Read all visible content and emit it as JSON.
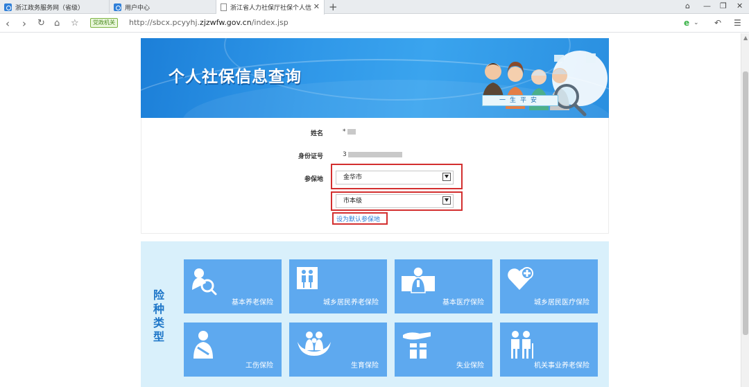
{
  "browser": {
    "tabs": [
      {
        "title": "浙江政务服务网（省级）"
      },
      {
        "title": "用户中心"
      },
      {
        "title": "浙江省人力社保厅社保个人信息"
      }
    ],
    "address": {
      "badge": "党政机关",
      "url_prefix": "http://sbcx.pcyyhj.",
      "url_domain": "zjzwfw.gov.cn",
      "url_suffix": "/index.jsp"
    }
  },
  "banner": {
    "title": "个人社保信息查询",
    "ribbon": "一生平安"
  },
  "form": {
    "name_label": "姓名",
    "name_value": "*",
    "id_label": "身份证号",
    "id_value": "3",
    "region_label": "参保地",
    "city_select": "金华市",
    "district_select": "市本级",
    "default_link": "设为默认参保地"
  },
  "insurance": {
    "title": "险种类型",
    "items": [
      {
        "label": "基本养老保险",
        "icon": "person-search-icon"
      },
      {
        "label": "城乡居民养老保险",
        "icon": "elderly-couple-icon"
      },
      {
        "label": "基本医疗保险",
        "icon": "doctor-icon"
      },
      {
        "label": "城乡居民医疗保险",
        "icon": "heart-plus-icon"
      },
      {
        "label": "工伤保险",
        "icon": "injured-person-icon"
      },
      {
        "label": "生育保险",
        "icon": "family-hands-icon"
      },
      {
        "label": "失业保险",
        "icon": "hand-box-icon"
      },
      {
        "label": "机关事业养老保险",
        "icon": "elderly-cane-icon"
      }
    ]
  },
  "colors": {
    "banner": "#2f97e8",
    "tile": "#5ea9ef",
    "panel": "#d9f0fb",
    "highlight": "#d32f2f"
  }
}
